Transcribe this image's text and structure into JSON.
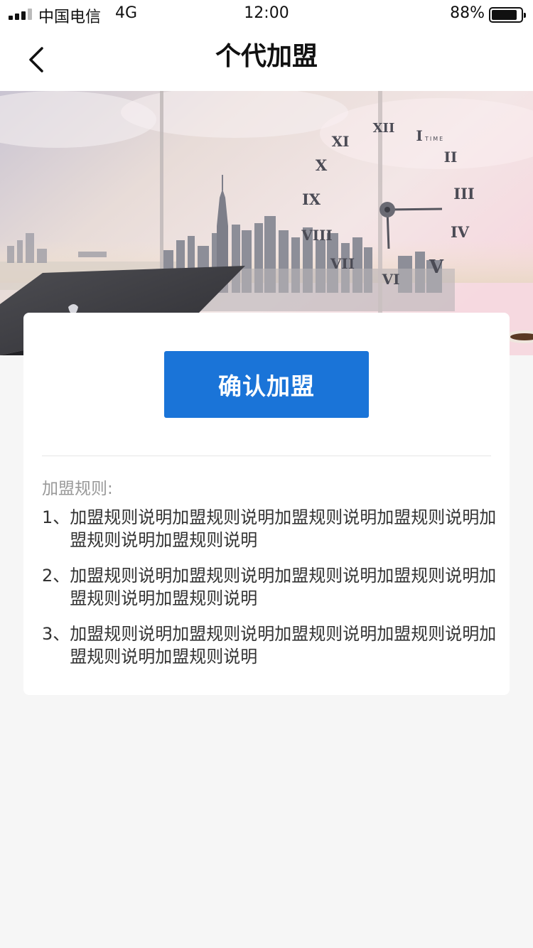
{
  "status_bar": {
    "carrier": "中国电信",
    "network": "4G",
    "time": "12:00",
    "battery": "88%",
    "battery_level": 0.88
  },
  "nav": {
    "title": "个代加盟",
    "back_icon": "chevron-left-icon"
  },
  "banner": {
    "clock_text": "TIME",
    "numerals": [
      "XII",
      "I",
      "II",
      "III",
      "IV",
      "V",
      "VI",
      "VII",
      "VIII",
      "IX",
      "X",
      "XI"
    ]
  },
  "card": {
    "confirm_label": "确认加盟",
    "rules_heading": "加盟规则:",
    "rules": [
      {
        "num": "1、",
        "text": "加盟规则说明加盟规则说明加盟规则说明加盟规则说明加盟规则说明加盟规则说明"
      },
      {
        "num": "2、",
        "text": "加盟规则说明加盟规则说明加盟规则说明加盟规则说明加盟规则说明加盟规则说明"
      },
      {
        "num": "3、",
        "text": "加盟规则说明加盟规则说明加盟规则说明加盟规则说明加盟规则说明加盟规则说明"
      }
    ]
  },
  "colors": {
    "accent": "#1a74d8",
    "background": "#f6f6f6",
    "card": "#ffffff"
  }
}
